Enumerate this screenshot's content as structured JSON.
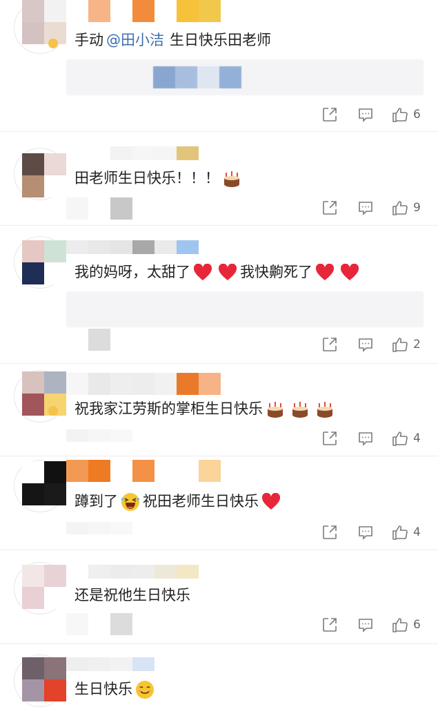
{
  "comments": [
    {
      "id": "c1",
      "text": "生日快乐田老师",
      "prefix": "手动",
      "mention": "@田小洁",
      "likes": "6"
    },
    {
      "id": "c2",
      "text": "田老师生日快乐！！！",
      "likes": "9"
    },
    {
      "id": "c3",
      "text_a": "我的妈呀，太甜了",
      "text_b": "我快齁死了",
      "likes": "2"
    },
    {
      "id": "c4",
      "text": "祝我家江劳斯的掌柜生日快乐",
      "likes": "4"
    },
    {
      "id": "c5",
      "text_a": "蹲到了",
      "text_b": "祝田老师生日快乐",
      "likes": "4"
    },
    {
      "id": "c6",
      "text": "还是祝他生日快乐",
      "likes": "6"
    },
    {
      "id": "c7",
      "text": "生日快乐"
    }
  ],
  "icons": {
    "share": "share-icon",
    "reply": "comment-icon",
    "like": "thumbs-up-icon",
    "cake": "birthday-cake-emoji",
    "heart": "red-heart-emoji",
    "laugh": "laughing-face-emoji",
    "smile": "smiling-face-emoji"
  },
  "colors": {
    "mention": "#3f6fb0",
    "text": "#222222",
    "muted": "#666666",
    "heart": "#e8263a"
  }
}
